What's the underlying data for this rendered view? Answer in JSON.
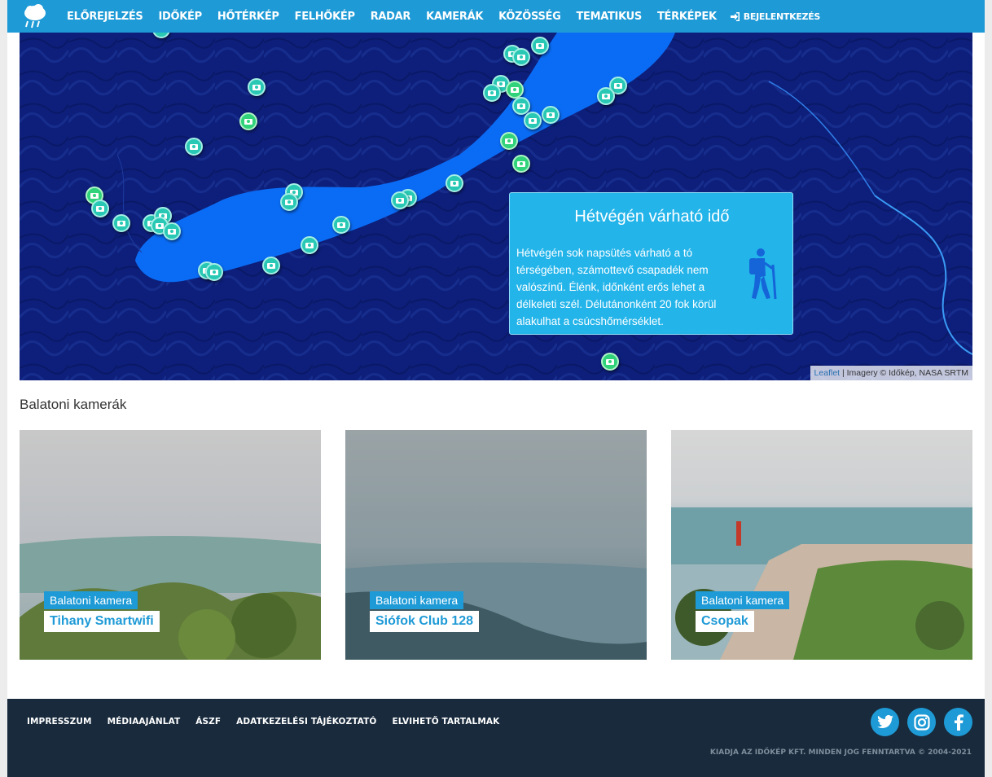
{
  "nav": {
    "items": [
      "ELŐREJELZÉS",
      "IDŐKÉP",
      "HŐTÉRKÉP",
      "FELHŐKÉP",
      "RADAR",
      "KAMERÁK",
      "KÖZÖSSÉG",
      "TEMATIKUS",
      "TÉRKÉPEK"
    ],
    "login": "BEJELENTKEZÉS"
  },
  "popup": {
    "title": "Hétvégén várható idő",
    "text": "Hétvégén sok napsütés várható a tó térségében, számottevő csapadék nem valószínű. Élénk, időnként erős lehet a délkeleti szél. Délutánonként 20 fok körül alakulhat a csúcshőmérséklet.",
    "icon": "hiker-icon"
  },
  "attribution": {
    "link": "Leaflet",
    "text": " | Imagery © Időkép, NASA SRTM"
  },
  "cameras_title": "Balatoni kamerák",
  "cameras": [
    {
      "tag": "Balatoni kamera",
      "name": "Tihany Smartwifi"
    },
    {
      "tag": "Balatoni kamera",
      "name": "Siófok Club 128"
    },
    {
      "tag": "Balatoni kamera",
      "name": "Csopak"
    }
  ],
  "footer": {
    "links": [
      "IMPRESSZUM",
      "MÉDIAAJÁNLAT",
      "ÁSZF",
      "ADATKEZELÉSI TÁJÉKOZTATÓ",
      "ELVIHETŐ TARTALMAK"
    ],
    "social": [
      "twitter-icon",
      "instagram-icon",
      "facebook-icon"
    ],
    "copyright": "KIADJA AZ IDŐKÉP KFT. MINDEN JOG FENNTARTVA © 2004-2021"
  },
  "colors": {
    "accent": "#1e9ad6",
    "lake": "#0a6cf5",
    "footer": "#182a3c"
  }
}
